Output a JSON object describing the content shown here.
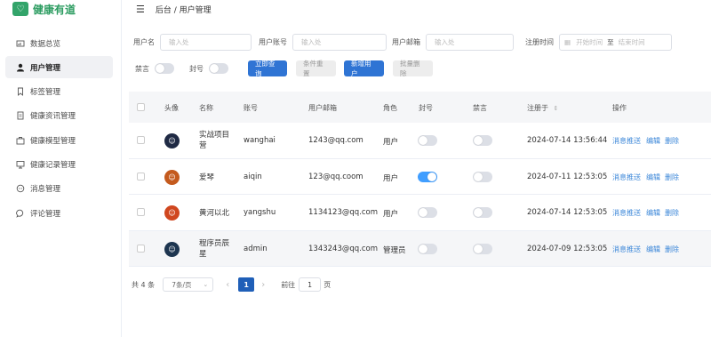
{
  "brand": {
    "name": "健康有道",
    "logo_icon": "heart-icon",
    "color": "#33a46a"
  },
  "breadcrumb": "后台 / 用户管理",
  "menu": [
    {
      "label": "数据总览",
      "icon": "bar-chart-icon"
    },
    {
      "label": "用户管理",
      "icon": "user-icon",
      "active": true
    },
    {
      "label": "标签管理",
      "icon": "bookmark-icon"
    },
    {
      "label": "健康资讯管理",
      "icon": "document-icon"
    },
    {
      "label": "健康模型管理",
      "icon": "briefcase-icon"
    },
    {
      "label": "健康记录管理",
      "icon": "monitor-icon"
    },
    {
      "label": "消息管理",
      "icon": "chat-icon"
    },
    {
      "label": "评论管理",
      "icon": "comment-icon"
    }
  ],
  "filters": {
    "username_label": "用户名",
    "username_placeholder": "输入处",
    "account_label": "用户账号",
    "account_placeholder": "输入处",
    "email_label": "用户邮箱",
    "email_placeholder": "输入处",
    "time_label": "注册时间",
    "start_placeholder": "开始时间",
    "range_sep": "至",
    "end_placeholder": "结束时间",
    "mute_label": "禁言",
    "ban_label": "封号",
    "query_button": "立即查询",
    "reset_button": "条件重置",
    "add_button": "新增用户",
    "batch_delete_button": "批量删除"
  },
  "table": {
    "headers": {
      "avatar": "头像",
      "name": "名称",
      "account": "账号",
      "email": "用户邮箱",
      "role": "角色",
      "ban": "封号",
      "mute": "禁言",
      "registered": "注册于",
      "actions": "操作"
    },
    "sort_icon": "sort-icon",
    "rows": [
      {
        "name": "实战项目营",
        "account": "wanghai",
        "email": "1243@qq.com",
        "role": "用户",
        "ban": false,
        "mute": false,
        "registered": "2024-07-14 13:56:44",
        "avatar_color": "#1f2a44"
      },
      {
        "name": "爱琴",
        "account": "aiqin",
        "email": "123@qq.coom",
        "role": "用户",
        "ban": true,
        "mute": false,
        "registered": "2024-07-11 12:53:05",
        "avatar_color": "#c45a1e"
      },
      {
        "name": "黄河以北",
        "account": "yangshu",
        "email": "1134123@qq.com",
        "role": "用户",
        "ban": false,
        "mute": false,
        "registered": "2024-07-14 12:53:05",
        "avatar_color": "#d0471f"
      },
      {
        "name": "程序员辰星",
        "account": "admin",
        "email": "1343243@qq.com",
        "role": "管理员",
        "ban": false,
        "mute": false,
        "registered": "2024-07-09 12:53:05",
        "avatar_color": "#1d3550"
      }
    ],
    "actions": {
      "push": "消息推送",
      "edit": "编辑",
      "delete": "删除"
    }
  },
  "pagination": {
    "total": "共 4 条",
    "page_size": "7条/页",
    "current": "1",
    "goto_prefix": "前往",
    "goto_value": "1",
    "goto_suffix": "页"
  },
  "colors": {
    "primary": "#2f74d4",
    "link": "#3a86d8",
    "toggle_on": "#409eff"
  }
}
